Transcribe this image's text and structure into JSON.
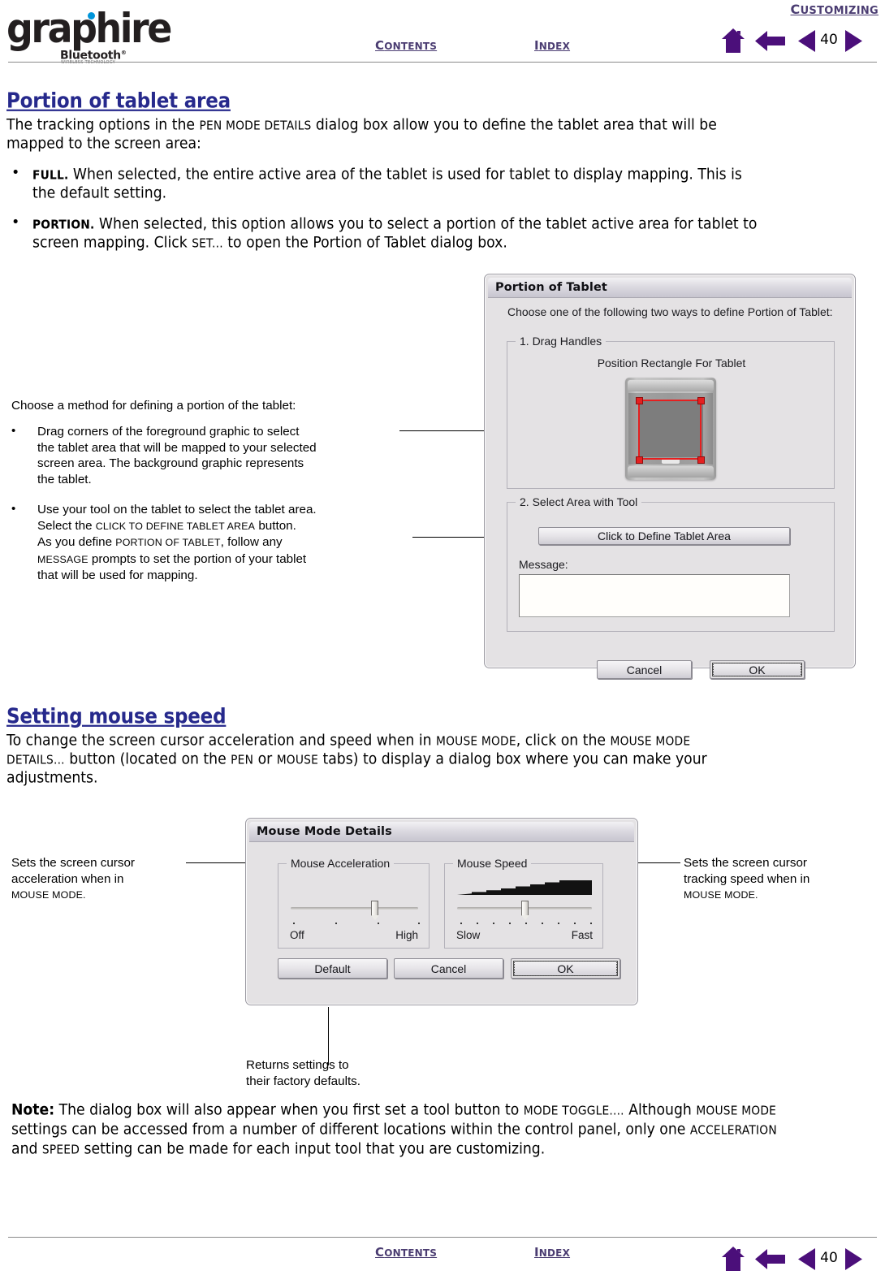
{
  "header": {
    "chapter_title": {
      "first": "C",
      "rest": "USTOMIZING"
    },
    "logo": {
      "word": "graphire",
      "sub": "Bluetooth",
      "tagline": "WIRELESS TECHNOLOGY"
    },
    "contents_label": {
      "first": "C",
      "rest": "ONTENTS"
    },
    "index_label": {
      "first": "I",
      "rest": "NDEX"
    },
    "page_number": "40",
    "icons": [
      "home-icon",
      "back-arrow-icon",
      "prev-page-icon",
      "next-page-icon"
    ]
  },
  "section1": {
    "heading": "Portion of tablet area",
    "intro_line1_a": "The tracking options in the ",
    "intro_line1_sc1": "PEN MODE DETAILS",
    "intro_line1_b": " dialog box allow you to define the tablet area that will be",
    "intro_line2": "mapped to the screen area:",
    "bullets": [
      {
        "term": "FULL.",
        "line1": "  When selected, the entire active area of the tablet is used for tablet to display mapping.  This is",
        "line2": "the default setting."
      },
      {
        "term": "PORTION.",
        "line1": "  When selected, this option allows you to select a portion of the tablet active area for tablet to",
        "line2_a": "screen mapping.  Click ",
        "line2_sc": "SET...",
        "line2_b": " to open the Portion of Tablet dialog box."
      }
    ]
  },
  "callout_portion": {
    "intro": "Choose a method for defining a portion of the tablet:",
    "bullet1": [
      "Drag corners of the foreground graphic to select",
      "the tablet area that will be mapped to your selected",
      "screen area.  The background graphic represents",
      "the tablet."
    ],
    "bullet2_l1": "Use your tool on the tablet to select the tablet area.",
    "bullet2_l2_a": "Select the ",
    "bullet2_l2_sc": "CLICK TO DEFINE TABLET AREA",
    "bullet2_l2_b": " button.",
    "bullet2_l3_a": "As you define ",
    "bullet2_l3_sc": "PORTION OF TABLET",
    "bullet2_l3_b": ", follow any",
    "bullet2_l4_sc": "MESSAGE",
    "bullet2_l4_b": " prompts to set the portion of your tablet",
    "bullet2_l5": "that will be used for mapping."
  },
  "dialog_portion": {
    "title": "Portion of Tablet",
    "instruction": "Choose one of the following two ways to define Portion of Tablet:",
    "group1_label": "1. Drag Handles",
    "group1_caption": "Position Rectangle For Tablet",
    "group2_label": "2. Select Area with Tool",
    "define_button": "Click to Define Tablet Area",
    "message_label": "Message:",
    "message_value": "",
    "cancel_button": "Cancel",
    "ok_button": "OK",
    "selection_color": "#e52020"
  },
  "section2": {
    "heading": "Setting mouse speed",
    "line1_a": "To change the screen cursor acceleration and speed when in ",
    "line1_sc1": "MOUSE MODE",
    "line1_b": ", click on the ",
    "line1_sc2": "MOUSE MODE",
    "line2_sc1": "DETAILS...",
    "line2_a": " button (located on the ",
    "line2_sc2": "PEN",
    "line2_b": " or ",
    "line2_sc3": "MOUSE",
    "line2_c": " tabs) to display a dialog box where you can make your",
    "line3": "adjustments."
  },
  "dialog_mouse": {
    "title": "Mouse Mode Details",
    "accel_group_label": "Mouse Acceleration",
    "accel_min_label": "Off",
    "accel_max_label": "High",
    "accel_ticks": 4,
    "accel_value_pct": 66,
    "speed_group_label": "Mouse Speed",
    "speed_min_label": "Slow",
    "speed_max_label": "Fast",
    "speed_ticks": 9,
    "speed_value_pct": 50,
    "default_button": "Default",
    "cancel_button": "Cancel",
    "ok_button": "OK"
  },
  "callouts_mouse": {
    "left": [
      "Sets the screen cursor",
      "acceleration when in",
      "MOUSE MODE."
    ],
    "left_l3_sc": "MOUSE MODE.",
    "right": [
      "Sets the screen cursor",
      "tracking speed when in",
      "MOUSE MODE."
    ],
    "right_l3_sc": "MOUSE MODE.",
    "bottom": [
      "Returns settings to",
      "their factory defaults."
    ]
  },
  "note": {
    "label": "Note:",
    "line1_a": " The dialog box will also appear when you first set a tool button to ",
    "line1_sc1": "MODE TOGGLE....",
    "line1_b": "  Although ",
    "line1_sc2": "MOUSE MODE",
    "line2_a": "settings can be accessed from a number of different locations within the control panel, only one ",
    "line2_sc": "ACCELERATION",
    "line3_a": "and ",
    "line3_sc": "SPEED",
    "line3_b": " setting can be made for each input tool that you are customizing."
  },
  "footer": {
    "contents_label": {
      "first": "C",
      "rest": "ONTENTS"
    },
    "index_label": {
      "first": "I",
      "rest": "NDEX"
    },
    "page_number": "40"
  }
}
